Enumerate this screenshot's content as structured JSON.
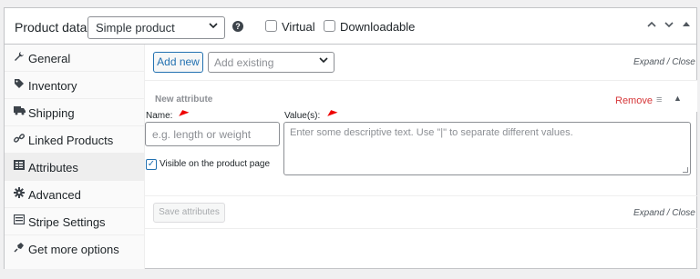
{
  "header": {
    "title": "Product data —",
    "product_type": "Simple product",
    "help_glyph": "?",
    "virtual_label": "Virtual",
    "downloadable_label": "Downloadable",
    "up_glyph": "⌃",
    "down_glyph": "⌄",
    "collapse_glyph": "▴"
  },
  "sidebar": {
    "items": [
      {
        "label": "General",
        "icon": "wrench-icon",
        "glyph": "🔧"
      },
      {
        "label": "Inventory",
        "icon": "tag-icon",
        "glyph": "◈"
      },
      {
        "label": "Shipping",
        "icon": "truck-icon",
        "glyph": "▮"
      },
      {
        "label": "Linked Products",
        "icon": "link-icon",
        "glyph": "∞"
      },
      {
        "label": "Attributes",
        "icon": "list-icon",
        "glyph": "▤"
      },
      {
        "label": "Advanced",
        "icon": "gear-icon",
        "glyph": "✱"
      },
      {
        "label": "Stripe Settings",
        "icon": "card-icon",
        "glyph": "▭"
      },
      {
        "label": "Get more options",
        "icon": "plugin-icon",
        "glyph": "✎"
      }
    ],
    "active_index": 4
  },
  "attributes": {
    "add_new_label": "Add new",
    "add_existing_placeholder": "Add existing",
    "expand_collapse_top": "Expand / Close",
    "new_attribute_title": "New attribute",
    "remove_label": "Remove",
    "menu_glyph": "≡",
    "collapse_glyph": "▲",
    "name_label": "Name:",
    "name_placeholder": "e.g. length or weight",
    "values_label": "Value(s):",
    "values_placeholder": "Enter some descriptive text. Use \"|\" to separate different values.",
    "visible_label": "Visible on the product page",
    "visible_checked": true,
    "check_glyph": "✓",
    "save_label": "Save attributes",
    "expand_collapse_bottom": "Expand / Close"
  },
  "colors": {
    "accent": "#2271b1",
    "remove": "#d63638",
    "annotation_arrow": "#e00000"
  }
}
